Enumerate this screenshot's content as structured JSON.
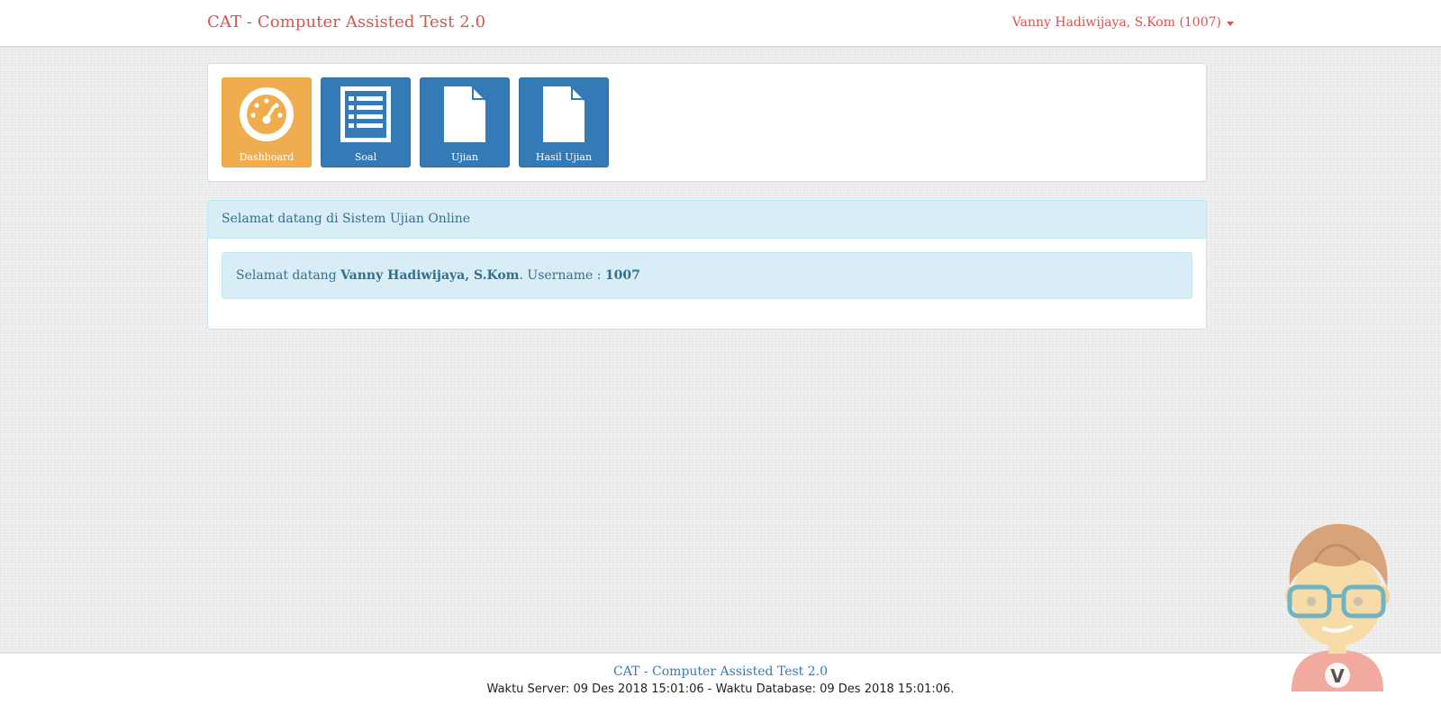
{
  "navbar": {
    "brand": "CAT - Computer Assisted Test 2.0",
    "user_label": "Vanny Hadiwijaya, S.Kom (1007)"
  },
  "tiles": [
    {
      "label": "Dashboard",
      "icon": "dashboard-icon",
      "color": "#f0ad4e"
    },
    {
      "label": "Soal",
      "icon": "list-icon",
      "color": "#337ab7"
    },
    {
      "label": "Ujian",
      "icon": "file-icon",
      "color": "#337ab7"
    },
    {
      "label": "Hasil Ujian",
      "icon": "file-icon",
      "color": "#337ab7"
    }
  ],
  "welcome": {
    "heading": "Selamat datang di Sistem Ujian Online",
    "prefix": "Selamat datang ",
    "name": "Vanny Hadiwijaya, S.Kom",
    "username_label": ". Username : ",
    "username": "1007"
  },
  "footer": {
    "title": "CAT - Computer Assisted Test 2.0",
    "time_text": "Waktu Server: 09 Des 2018 15:01:06 - Waktu Database: 09 Des 2018 15:01:06."
  },
  "mascot": {
    "badge_letter": "V"
  },
  "colors": {
    "brand_red": "#d9534f",
    "tile_orange": "#f0ad4e",
    "tile_blue": "#337ab7",
    "info_bg": "#d9edf7",
    "info_text": "#31708f"
  }
}
